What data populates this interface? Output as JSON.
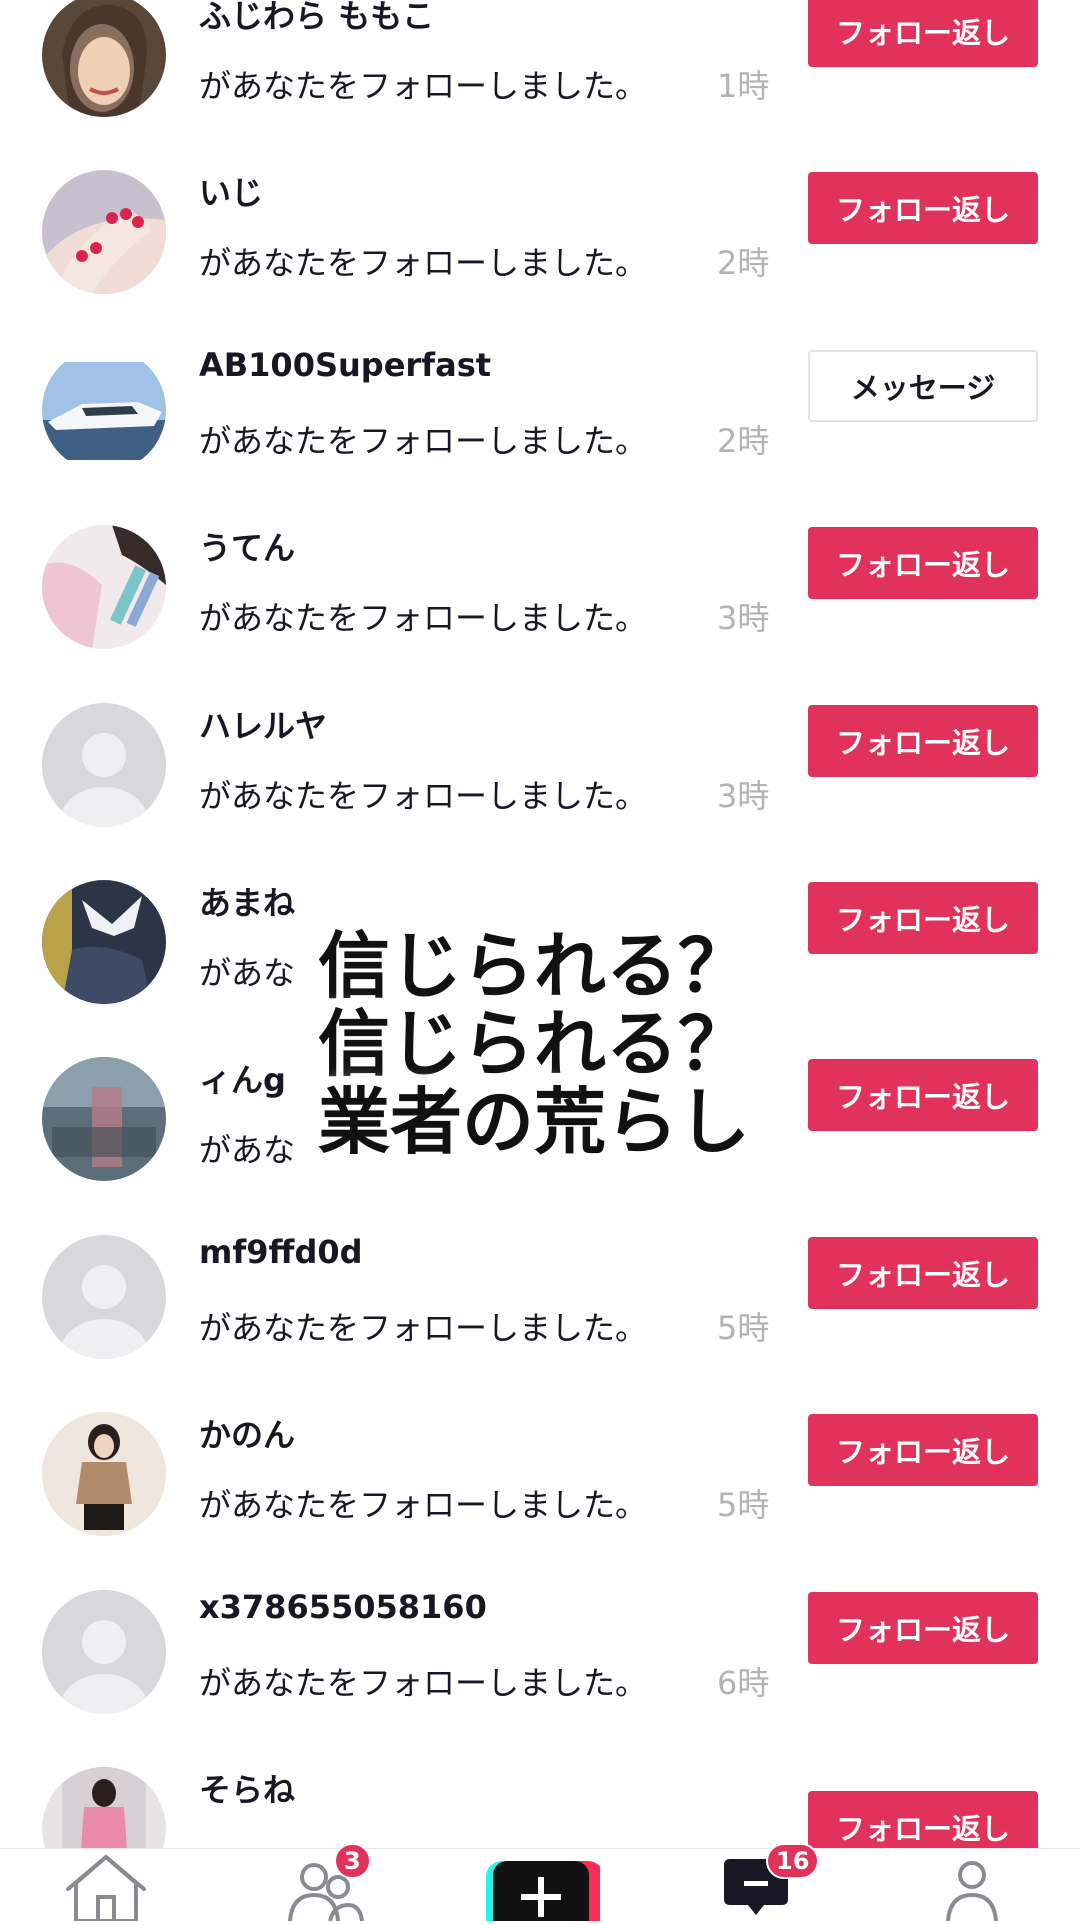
{
  "notifications": [
    {
      "name": "ふじわら ももこ",
      "message": "があなたをフォローしました。",
      "time": "1時",
      "button": "フォロー返し",
      "button_type": "follow",
      "avatar": "photo-woman"
    },
    {
      "name": "いじ",
      "message": "があなたをフォローしました。",
      "time": "2時",
      "button": "フォロー返し",
      "button_type": "follow",
      "avatar": "photo-nails"
    },
    {
      "name": "AB100Superfast",
      "message": "があなたをフォローしました。",
      "time": "2時",
      "button": "メッセージ",
      "button_type": "message",
      "avatar": "photo-yacht"
    },
    {
      "name": "うてん",
      "message": "があなたをフォローしました。",
      "time": "3時",
      "button": "フォロー返し",
      "button_type": "follow",
      "avatar": "photo-pink"
    },
    {
      "name": "ハレルヤ",
      "message": "があなたをフォローしました。",
      "time": "3時",
      "button": "フォロー返し",
      "button_type": "follow",
      "avatar": "default"
    },
    {
      "name": "あまね",
      "message": "があなたをフォローしました。",
      "time": "",
      "button": "フォロー返し",
      "button_type": "follow",
      "avatar": "photo-ribbon"
    },
    {
      "name": "ィんg",
      "message": "があなたをフォローしました。",
      "time": "",
      "button": "フォロー返し",
      "button_type": "follow",
      "avatar": "photo-blur"
    },
    {
      "name": "mf9ffd0d",
      "message": "があなたをフォローしました。",
      "time": "5時",
      "button": "フォロー返し",
      "button_type": "follow",
      "avatar": "default"
    },
    {
      "name": "かのん",
      "message": "があなたをフォローしました。",
      "time": "5時",
      "button": "フォロー返し",
      "button_type": "follow",
      "avatar": "photo-girl"
    },
    {
      "name": "x378655058160",
      "message": "があなたをフォローしました。",
      "time": "6時",
      "button": "フォロー返し",
      "button_type": "follow",
      "avatar": "default"
    },
    {
      "name": "そらね",
      "message": "",
      "time": "",
      "button": "フォロー返し",
      "button_type": "follow",
      "avatar": "photo-pinkgirl"
    }
  ],
  "overlay": {
    "line1": "信じられる？",
    "line2": "信じられる？",
    "line3": "業者の荒らし"
  },
  "navbar": {
    "items": [
      {
        "icon": "home-icon"
      },
      {
        "icon": "friends-icon",
        "badge": "3"
      },
      {
        "icon": "create-plus-icon"
      },
      {
        "icon": "inbox-icon",
        "badge": "16"
      },
      {
        "icon": "profile-icon"
      }
    ]
  },
  "colors": {
    "accent": "#e0325b",
    "time_gray": "#b3b3b3",
    "text": "#161823"
  }
}
